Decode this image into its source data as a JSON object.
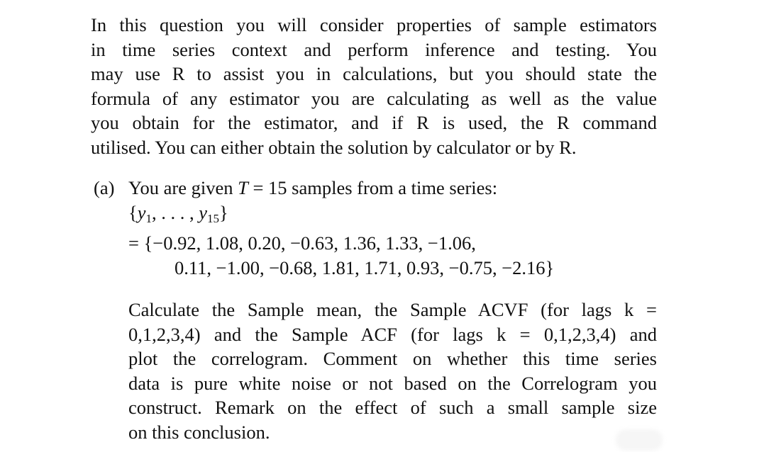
{
  "intro": {
    "lines": [
      "In this question you will consider properties of sample estimators",
      "in time series context and perform inference and testing.  You",
      "may use R to assist you in calculations, but you should state the",
      "formula of any estimator you are calculating as well as the value",
      "you obtain for the estimator, and if R is used, the R command",
      "utilised. You can either obtain the solution by calculator or by R."
    ]
  },
  "part_a": {
    "label": "(a)",
    "given_prefix": "You are given ",
    "given_var": "T",
    "given_suffix": " = 15 samples from a time series:",
    "set_open": "{",
    "set_var1": "y",
    "set_sub1": "1",
    "set_mid": ", . . . , ",
    "set_var2": "y",
    "set_sub2": "15",
    "set_close": "}",
    "values_line1": "= {−0.92, 1.08, 0.20, −0.63, 1.36, 1.33, −1.06,",
    "values_line2": "0.11, −1.00, −0.68, 1.81, 1.71, 0.93, −0.75, −2.16}",
    "sample_values": [
      -0.92,
      1.08,
      0.2,
      -0.63,
      1.36,
      1.33,
      -1.06,
      0.11,
      -1.0,
      -0.68,
      1.81,
      1.71,
      0.93,
      -0.75,
      -2.16
    ],
    "task_lines": [
      "Calculate the Sample mean, the Sample ACVF (for lags k =",
      "0,1,2,3,4) and the Sample ACF (for lags k = 0,1,2,3,4) and",
      "plot the correlogram.  Comment on whether this time series",
      "data is pure white noise or not based on the Correlogram you",
      "construct.  Remark on the effect of such a small sample size",
      "on this conclusion."
    ]
  }
}
